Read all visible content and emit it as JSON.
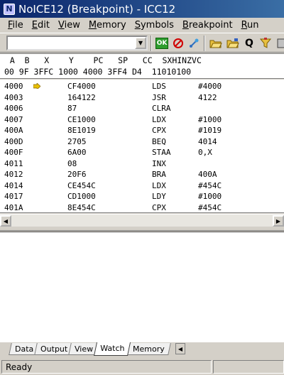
{
  "window": {
    "title": "NoICE12 (Breakpoint)  - ICC12",
    "icon": "noice-app-icon"
  },
  "menu": [
    {
      "label": "File",
      "underline": "F"
    },
    {
      "label": "Edit",
      "underline": "E"
    },
    {
      "label": "View",
      "underline": "V"
    },
    {
      "label": "Memory",
      "underline": "M"
    },
    {
      "label": "Symbols",
      "underline": "S"
    },
    {
      "label": "Breakpoint",
      "underline": "B"
    },
    {
      "label": "Run",
      "underline": "R"
    }
  ],
  "toolbar": {
    "combo_value": "",
    "buttons": [
      {
        "name": "go-ok-button",
        "icon": "ok-icon",
        "text": "OK"
      },
      {
        "name": "stop-button",
        "icon": "stop-icon"
      },
      {
        "name": "step-button",
        "icon": "step-icon"
      },
      {
        "name": "open-button",
        "icon": "folder-open-icon"
      },
      {
        "name": "load-button",
        "icon": "folder-load-icon"
      },
      {
        "name": "find-button",
        "icon": "q-icon",
        "text": "Q"
      },
      {
        "name": "funnel-button",
        "icon": "funnel-icon"
      },
      {
        "name": "tools-button",
        "icon": "tools-icon"
      }
    ]
  },
  "registers": {
    "header": "  A  B   X    Y    PC   SP   CC  SXHINZVC",
    "values": "00 9F 3FFC 1000 4000 3FF4 D4  11010100"
  },
  "code": [
    {
      "addr": "4000",
      "hex": "CF4000",
      "op": "LDS",
      "arg": "#4000",
      "current": true
    },
    {
      "addr": "4003",
      "hex": "164122",
      "op": "JSR",
      "arg": "4122"
    },
    {
      "addr": "4006",
      "hex": "87",
      "op": "CLRA",
      "arg": ""
    },
    {
      "addr": "4007",
      "hex": "CE1000",
      "op": "LDX",
      "arg": "#1000"
    },
    {
      "addr": "400A",
      "hex": "8E1019",
      "op": "CPX",
      "arg": "#1019"
    },
    {
      "addr": "400D",
      "hex": "2705",
      "op": "BEQ",
      "arg": "4014"
    },
    {
      "addr": "400F",
      "hex": "6A00",
      "op": "STAA",
      "arg": "0,X"
    },
    {
      "addr": "4011",
      "hex": "08",
      "op": "INX",
      "arg": ""
    },
    {
      "addr": "4012",
      "hex": "20F6",
      "op": "BRA",
      "arg": "400A"
    },
    {
      "addr": "4014",
      "hex": "CE454C",
      "op": "LDX",
      "arg": "#454C"
    },
    {
      "addr": "4017",
      "hex": "CD1000",
      "op": "LDY",
      "arg": "#1000"
    },
    {
      "addr": "401A",
      "hex": "8E454C",
      "op": "CPX",
      "arg": "#454C"
    }
  ],
  "tabs": [
    {
      "label": "Data",
      "active": false
    },
    {
      "label": "Output",
      "active": false
    },
    {
      "label": "View",
      "active": false
    },
    {
      "label": "Watch",
      "active": true
    },
    {
      "label": "Memory",
      "active": false
    }
  ],
  "status": {
    "text": "Ready"
  },
  "colors": {
    "titlebar_start": "#0a246a",
    "titlebar_end": "#3a6ea5",
    "pc_arrow": "#e8c000"
  }
}
